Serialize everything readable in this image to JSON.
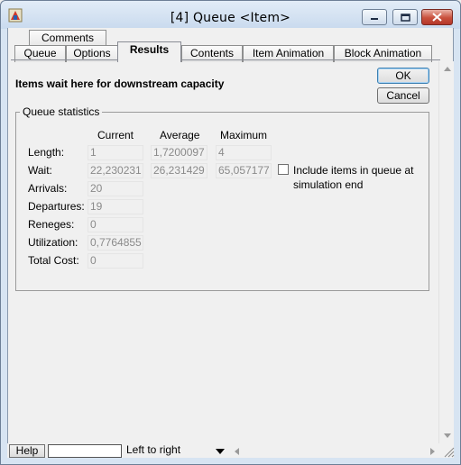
{
  "window": {
    "title": "[4]   Queue   <Item>"
  },
  "tabs": {
    "comments": "Comments",
    "queue": "Queue",
    "options": "Options",
    "results": "Results",
    "contents": "Contents",
    "item_animation": "Item Animation",
    "block_animation": "Block Animation"
  },
  "heading": "Items wait here for downstream capacity",
  "buttons": {
    "ok": "OK",
    "cancel": "Cancel"
  },
  "stats": {
    "group_title": "Queue statistics",
    "columns": {
      "current": "Current",
      "average": "Average",
      "maximum": "Maximum"
    },
    "rows": {
      "length": {
        "label": "Length:",
        "current": "1",
        "average": "1,7200097",
        "maximum": "4"
      },
      "wait": {
        "label": "Wait:",
        "current": "22,230231",
        "average": "26,231429",
        "maximum": "65,057177"
      },
      "arrivals": {
        "label": "Arrivals:",
        "current": "20"
      },
      "departures": {
        "label": "Departures:",
        "current": "19"
      },
      "reneges": {
        "label": "Reneges:",
        "current": "0"
      },
      "utilization": {
        "label": "Utilization:",
        "current": "0,7764855"
      },
      "total_cost": {
        "label": "Total Cost:",
        "current": "0"
      }
    },
    "include_checkbox": {
      "label": "Include items in queue at simulation end",
      "checked": false
    }
  },
  "bottom": {
    "help": "Help",
    "status_value": "",
    "combo_value": "Left to right"
  },
  "colors": {
    "frame": "#d7e4f2",
    "client": "#f0f0f0",
    "close_button": "#c9503c",
    "readonly_text": "#8a8a8a"
  },
  "icons": [
    "app-icon",
    "minimize-icon",
    "maximize-icon",
    "close-icon",
    "scroll-up-arrow-icon",
    "scroll-down-arrow-icon",
    "scroll-left-arrow-icon",
    "scroll-right-arrow-icon",
    "dropdown-arrow-icon",
    "resize-grip-icon"
  ]
}
